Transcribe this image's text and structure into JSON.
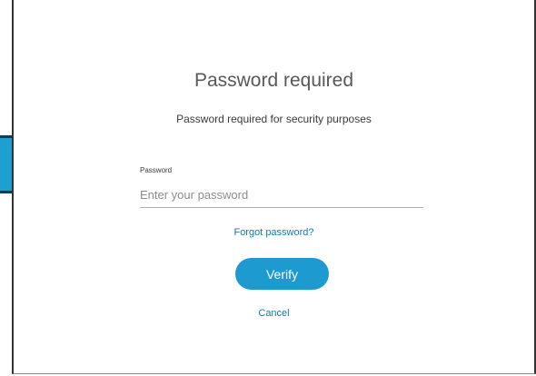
{
  "dialog": {
    "title": "Password required",
    "subtitle": "Password required for security purposes",
    "password": {
      "label": "Password",
      "placeholder": "Enter your password",
      "value": ""
    },
    "forgot_label": "Forgot password?",
    "verify_label": "Verify",
    "cancel_label": "Cancel"
  },
  "colors": {
    "accent": "#1d9bd1",
    "link": "#0b7fb0",
    "title_text": "#58585b",
    "background_shape_fill": "#1e9fd2",
    "background_shape_border": "#0b3d55"
  }
}
